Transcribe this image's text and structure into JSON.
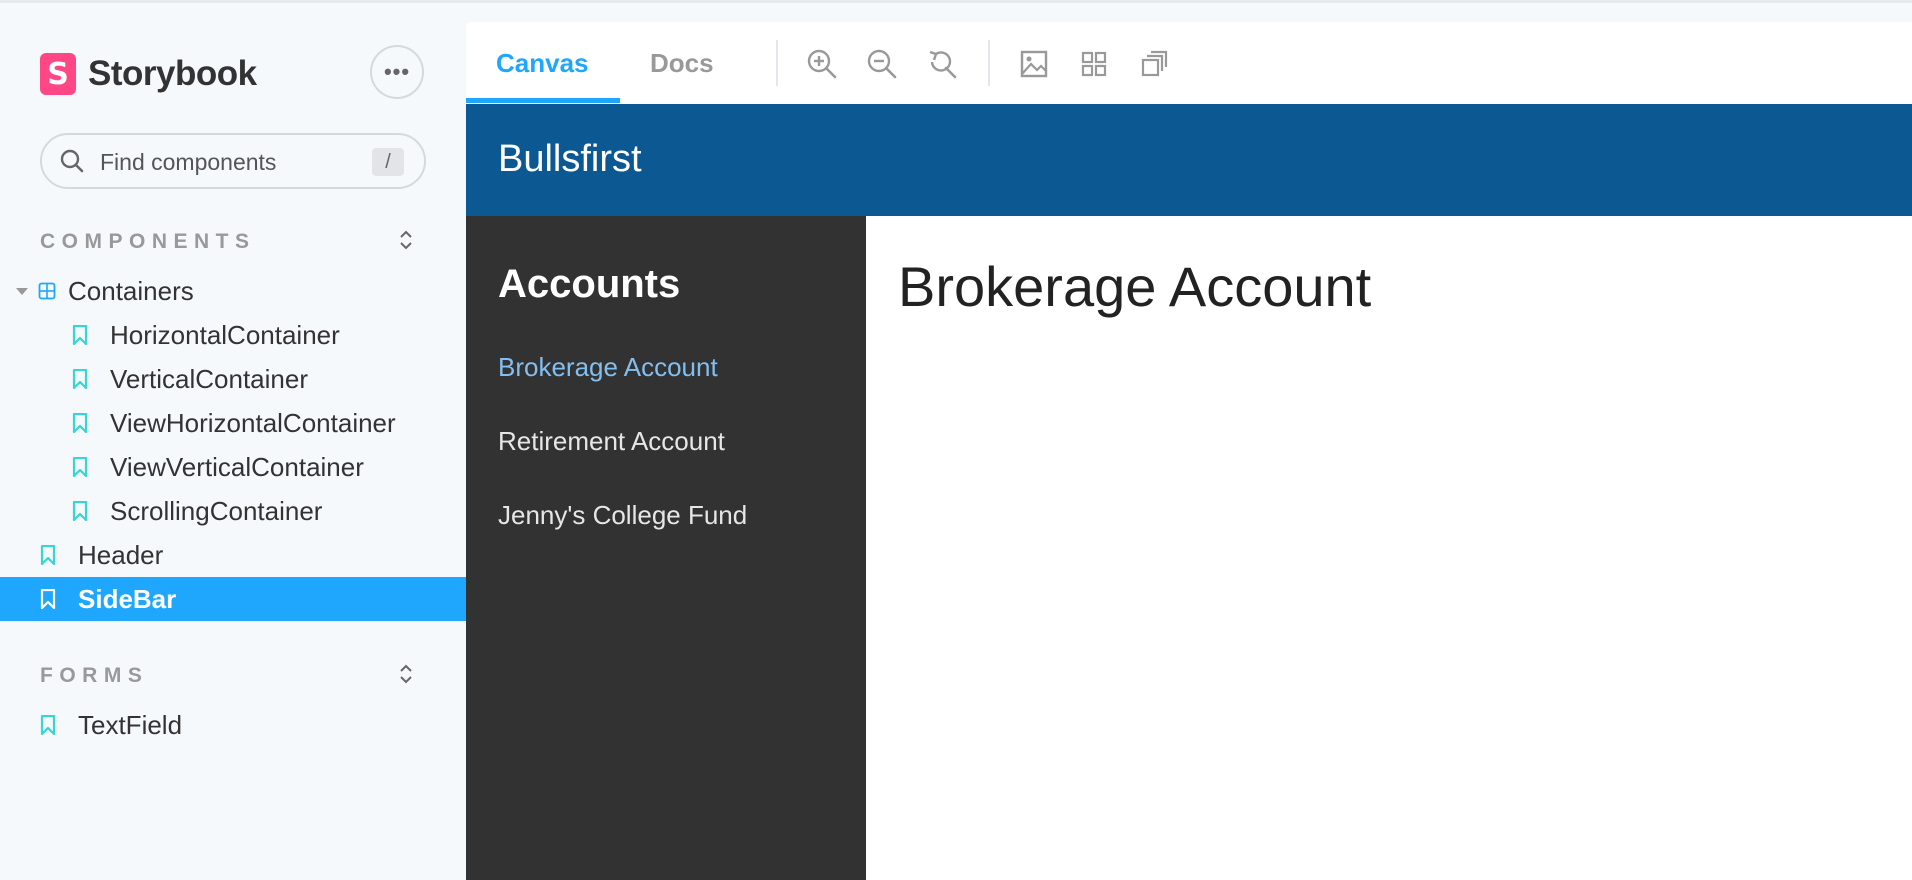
{
  "sidebar": {
    "brand": {
      "logo_letter": "S",
      "name": "Storybook",
      "logo_color": "#ff4785"
    },
    "menu_icon": "ellipsis-icon",
    "search": {
      "placeholder": "Find components",
      "shortcut": "/"
    },
    "sections": [
      {
        "title": "COMPONENTS",
        "items": [
          {
            "label": "Containers",
            "type": "group",
            "expanded": true
          },
          {
            "label": "HorizontalContainer",
            "type": "story",
            "level": 1
          },
          {
            "label": "VerticalContainer",
            "type": "story",
            "level": 1
          },
          {
            "label": "ViewHorizontalContainer",
            "type": "story",
            "level": 1
          },
          {
            "label": "ViewVerticalContainer",
            "type": "story",
            "level": 1
          },
          {
            "label": "ScrollingContainer",
            "type": "story",
            "level": 1
          },
          {
            "label": "Header",
            "type": "story",
            "level": 0
          },
          {
            "label": "SideBar",
            "type": "story",
            "level": 0,
            "selected": true
          }
        ]
      },
      {
        "title": "FORMS",
        "items": [
          {
            "label": "TextField",
            "type": "story",
            "level": 0
          }
        ]
      }
    ]
  },
  "toolbar": {
    "tabs": [
      {
        "label": "Canvas",
        "active": true
      },
      {
        "label": "Docs",
        "active": false
      }
    ],
    "tools": [
      "zoom-in-icon",
      "zoom-out-icon",
      "reset-zoom-icon",
      "background-icon",
      "grid-icon",
      "outline-icon"
    ]
  },
  "preview": {
    "header_title": "Bullsfirst",
    "side_title": "Accounts",
    "accounts": [
      {
        "label": "Brokerage Account",
        "active": true
      },
      {
        "label": "Retirement Account",
        "active": false
      },
      {
        "label": "Jenny's College Fund",
        "active": false
      }
    ],
    "main_title": "Brokerage Account"
  },
  "colors": {
    "accent": "#1ea7fd",
    "bookmark": "#37d5d3",
    "app_header": "#0b5892",
    "app_sidebar": "#323232",
    "active_link": "#82bff0"
  }
}
